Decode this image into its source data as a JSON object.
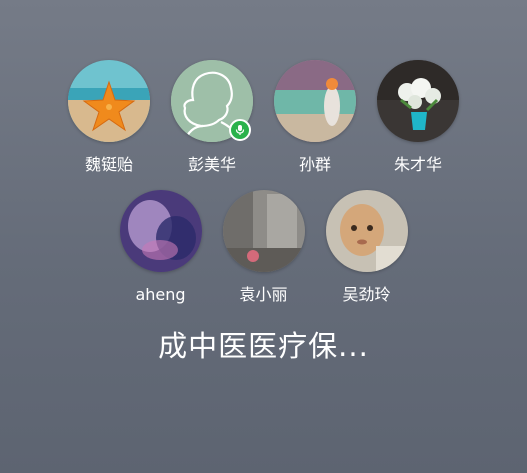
{
  "call": {
    "group_name": "成中医医疗保...",
    "members_row1": [
      {
        "name": "魏铤贻",
        "avatar_icon": "starfish-beach-photo"
      },
      {
        "name": "彭美华",
        "avatar_icon": "default-person-icon",
        "speaking": true
      },
      {
        "name": "孙群",
        "avatar_icon": "poolside-photo"
      },
      {
        "name": "朱才华",
        "avatar_icon": "flower-vase-photo"
      }
    ],
    "members_row2": [
      {
        "name": "aheng",
        "avatar_icon": "blurred-purple-photo"
      },
      {
        "name": "袁小丽",
        "avatar_icon": "room-photo"
      },
      {
        "name": "吴劲玲",
        "avatar_icon": "baby-photo"
      }
    ],
    "colors": {
      "background": "#6b7280",
      "text": "#ffffff",
      "speaking_badge": "#2bb24c",
      "default_avatar": "#9ebfa8"
    }
  }
}
